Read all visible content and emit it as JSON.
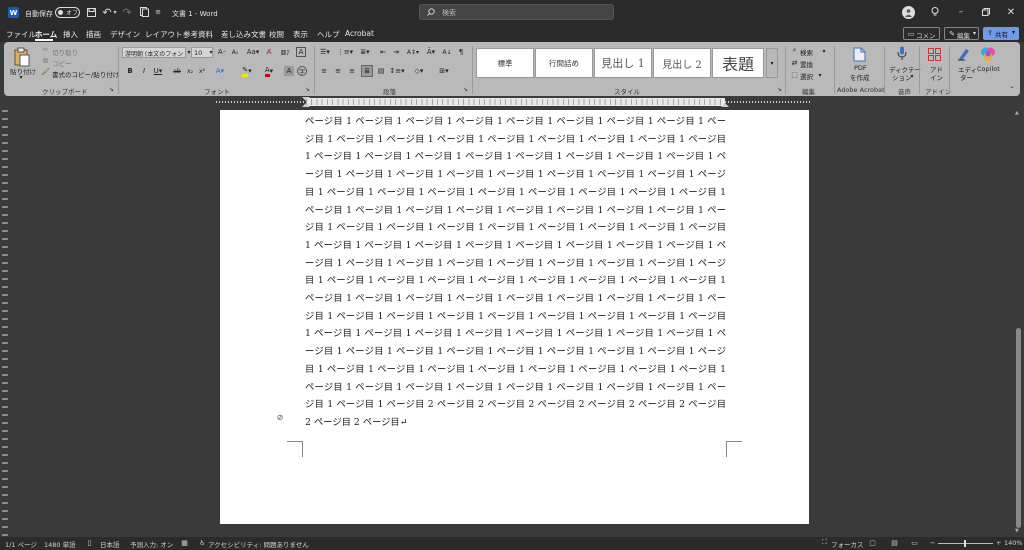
{
  "titlebar": {
    "autosave_label": "自動保存",
    "autosave_state": "オフ",
    "doc_title": "文書 1 - Word",
    "search_placeholder": "検索"
  },
  "menu": [
    "ファイル",
    "ホーム",
    "挿入",
    "描画",
    "デザイン",
    "レイアウト",
    "参考資料",
    "差し込み文書",
    "校閲",
    "表示",
    "ヘルプ",
    "Acrobat"
  ],
  "menu_active_index": 1,
  "menu_right": {
    "comment": "コメント",
    "edit": "編集",
    "share": "共有"
  },
  "ribbon": {
    "clipboard": {
      "paste": "貼り付け",
      "cut": "切り取り",
      "copy": "コピー",
      "format_painter": "書式のコピー/貼り付け",
      "label": "クリップボード"
    },
    "font": {
      "name": "游明朝 (本文のフォン",
      "size": "10",
      "label": "フォント"
    },
    "paragraph": {
      "label": "段落"
    },
    "styles": {
      "items": [
        "標準",
        "行間詰め",
        "見出し 1",
        "見出し 2",
        "表題"
      ],
      "label": "スタイル"
    },
    "editing": {
      "find": "検索",
      "replace": "置換",
      "select": "選択",
      "label": "編集"
    },
    "acrobat": {
      "pdf_line1": "PDF",
      "pdf_line2": "を作成",
      "label": "Adobe Acrobat"
    },
    "voice": {
      "dictate_line1": "ディクテー",
      "dictate_line2": "ション",
      "label": "音声"
    },
    "addins": {
      "addin_line1": "アド",
      "addin_line2": "イン",
      "label": "アドイン"
    },
    "editor": {
      "line1": "エディ",
      "line2": "ター"
    },
    "copilot": {
      "label": "Copilot"
    }
  },
  "document": {
    "lines": [
      "ページ目 1 ページ目 1 ページ目 1 ページ目 1 ページ目 1 ページ目 1 ページ目 1 ページ目 1 ペー",
      "ジ目 1 ページ目 1 ページ目 1 ページ目 1 ページ目 1 ページ目 1 ページ目 1 ページ目 1 ページ目",
      "1 ページ目 1 ページ目 1 ページ目 1 ページ目 1 ページ目 1 ページ目 1 ページ目 1 ページ目 1 ペ",
      "ージ目 1 ページ目 1 ページ目 1 ページ目 1 ページ目 1 ページ目 1 ページ目 1 ページ目 1 ページ",
      "目 1 ページ目 1 ページ目 1 ページ目 1 ページ目 1 ページ目 1 ページ目 1 ページ目 1 ページ目 1",
      "ページ目 1 ページ目 1 ページ目 1 ページ目 1 ページ目 1 ページ目 1 ページ目 1 ページ目 1 ペー",
      "ジ目 1 ページ目 1 ページ目 1 ページ目 1 ページ目 1 ページ目 1 ページ目 1 ページ目 1 ページ目",
      "1 ページ目 1 ページ目 1 ページ目 1 ページ目 1 ページ目 1 ページ目 1 ページ目 1 ページ目 1 ペ",
      "ージ目 1 ページ目 1 ページ目 1 ページ目 1 ページ目 1 ページ目 1 ページ目 1 ページ目 1 ページ",
      "目 1 ページ目 1 ページ目 1 ページ目 1 ページ目 1 ページ目 1 ページ目 1 ページ目 1 ページ目 1",
      "ページ目 1 ページ目 1 ページ目 1 ページ目 1 ページ目 1 ページ目 1 ページ目 1 ページ目 1 ペー",
      "ジ目 1 ページ目 1 ページ目 1 ページ目 1 ページ目 1 ページ目 1 ページ目 1 ページ目 1 ページ目",
      "1 ページ目 1 ページ目 1 ページ目 1 ページ目 1 ページ目 1 ページ目 1 ページ目 1 ページ目 1 ペ",
      "ージ目 1 ページ目 1 ページ目 1 ページ目 1 ページ目 1 ページ目 1 ページ目 1 ページ目 1 ページ",
      "目 1 ページ目 1 ページ目 1 ページ目 1 ページ目 1 ページ目 1 ページ目 1 ページ目 1 ページ目 1",
      "ページ目 1 ページ目 1 ページ目 1 ページ目 1 ページ目 1 ページ目 1 ページ目 1 ページ目 1 ペー",
      "ジ目 1 ページ目 1 ページ目 2 ページ目 2 ページ目 2 ページ目 2 ページ目 2 ページ目 2 ページ目",
      "2 ページ目 2 ページ目↵"
    ]
  },
  "status": {
    "page": "1/1 ページ",
    "words": "1480 単語",
    "language": "日本語",
    "predict": "予測入力: オン",
    "accessibility": "アクセシビリティ: 問題ありません",
    "focus": "フォーカス",
    "zoom": "140%"
  },
  "colors": {
    "accent": "#185abd",
    "ribbon_bg": "#b9b9b9",
    "chrome_bg": "#2b2b2b"
  }
}
